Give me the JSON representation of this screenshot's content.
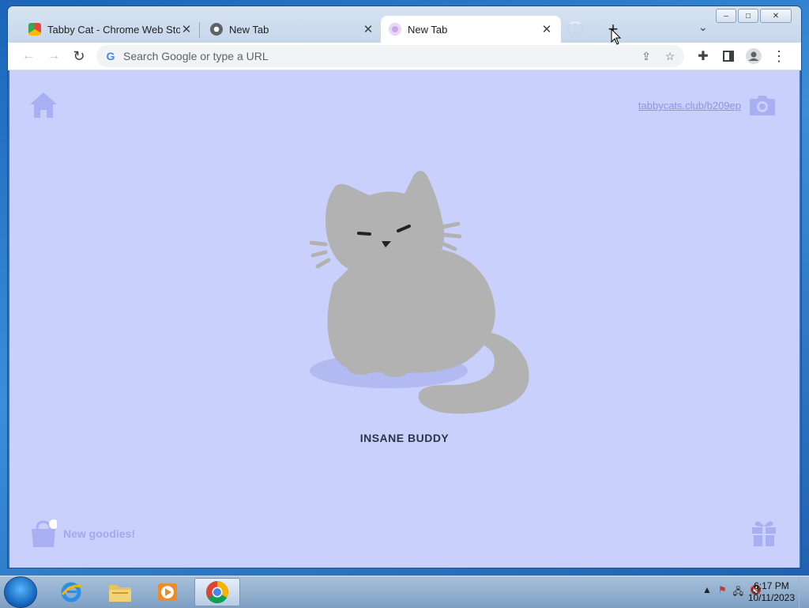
{
  "window": {
    "controls": {
      "minimize": "–",
      "maximize": "□",
      "close": "✕"
    }
  },
  "tabs": [
    {
      "title": "Tabby Cat - Chrome Web Store",
      "icon": "chrome-web-store-icon",
      "active": false
    },
    {
      "title": "New Tab",
      "icon": "chrome-icon",
      "active": false
    },
    {
      "title": "New Tab",
      "icon": "tabby-cat-icon",
      "active": true
    }
  ],
  "tab_close_glyph": "✕",
  "new_tab_glyph": "+",
  "tab_search_glyph": "⌄",
  "toolbar": {
    "back": "←",
    "forward": "→",
    "reload": "↻",
    "omnibox_placeholder": "Search Google or type a URL",
    "share": "⇪",
    "bookmark": "☆",
    "extensions": "✚",
    "side_panel": "▮",
    "menu": "⋮"
  },
  "content": {
    "share_link": "tabbycats.club/b209ep",
    "cat_name": "INSANE BUDDY",
    "goodies_label": "New goodies!",
    "background_color": "#c9d0fb",
    "cat_color": "#b2b2b2"
  },
  "taskbar": {
    "apps": [
      "internet-explorer-icon",
      "file-explorer-icon",
      "media-player-icon",
      "chrome-icon"
    ],
    "tray_arrow": "▲",
    "time": "6:17 PM",
    "date": "10/11/2023"
  }
}
